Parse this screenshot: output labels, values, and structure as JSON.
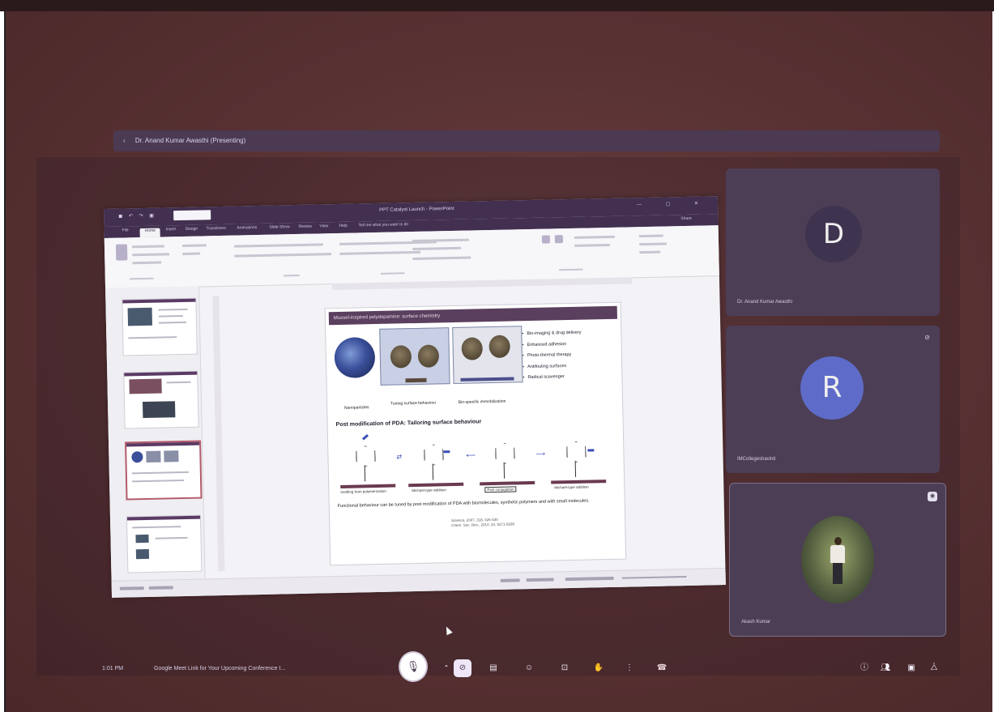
{
  "meeting": {
    "presenter_banner": "Dr. Anand Kumar Awasthi (Presenting)",
    "time": "1:01 PM",
    "title": "Google Meet Link for Your Upcoming Conference I..."
  },
  "presentation": {
    "window_title": "PPT Catalyst Launch - PowerPoint",
    "tabs": [
      "File",
      "Home",
      "Insert",
      "Design",
      "Transitions",
      "Animations",
      "Slide Show",
      "Review",
      "View",
      "Help",
      "Tell me what you want to do"
    ],
    "active_tab": "Home",
    "share_label": "Share"
  },
  "slide": {
    "title": "Mussel-inspired polydopamine: surface chemistry",
    "bullets": [
      "Bio-imaging & drug delivery",
      "Enhanced adhesion",
      "Photo-thermal therapy",
      "Antifouling surfaces",
      "Radical scavenger"
    ],
    "captions": [
      "Nanoparticles",
      "Tuning surface behaviour",
      "Bio-specific immobilization"
    ],
    "subheading": "Post modification of PDA: Tailoring surface behaviour",
    "surface_labels": [
      "Grafting from polymerization",
      "Michael-type addition",
      "Post conjugation",
      "Michael-type addition"
    ],
    "body": "Functional behaviour can be tuned by post modification of PDA with biomolecules, synthetic polymers and with small molecules.",
    "references": [
      "Science, 2007, 318, 426-430",
      "Chem. Soc. Rev., 2014, 43, 8271-8298"
    ]
  },
  "participants": [
    {
      "name": "Dr. Anand Kumar Awasthi",
      "initial": "D",
      "avatar_color": "#3f3450"
    },
    {
      "name": "IMCollegeshavinti",
      "initial": "R",
      "avatar_color": "#5e6bc8"
    },
    {
      "name": "Akash Kumar",
      "initial": "",
      "avatar_color": ""
    }
  ],
  "controls": {
    "mic": "microphone-icon",
    "camera": "camera-icon",
    "captions": "captions-icon",
    "emoji": "emoji-icon",
    "present": "present-icon",
    "raise_hand": "raise-hand-icon",
    "more": "more-options-icon",
    "end": "end-call-icon",
    "info": "info-icon",
    "people": "people-icon",
    "chat": "chat-icon",
    "activities": "activities-icon"
  }
}
